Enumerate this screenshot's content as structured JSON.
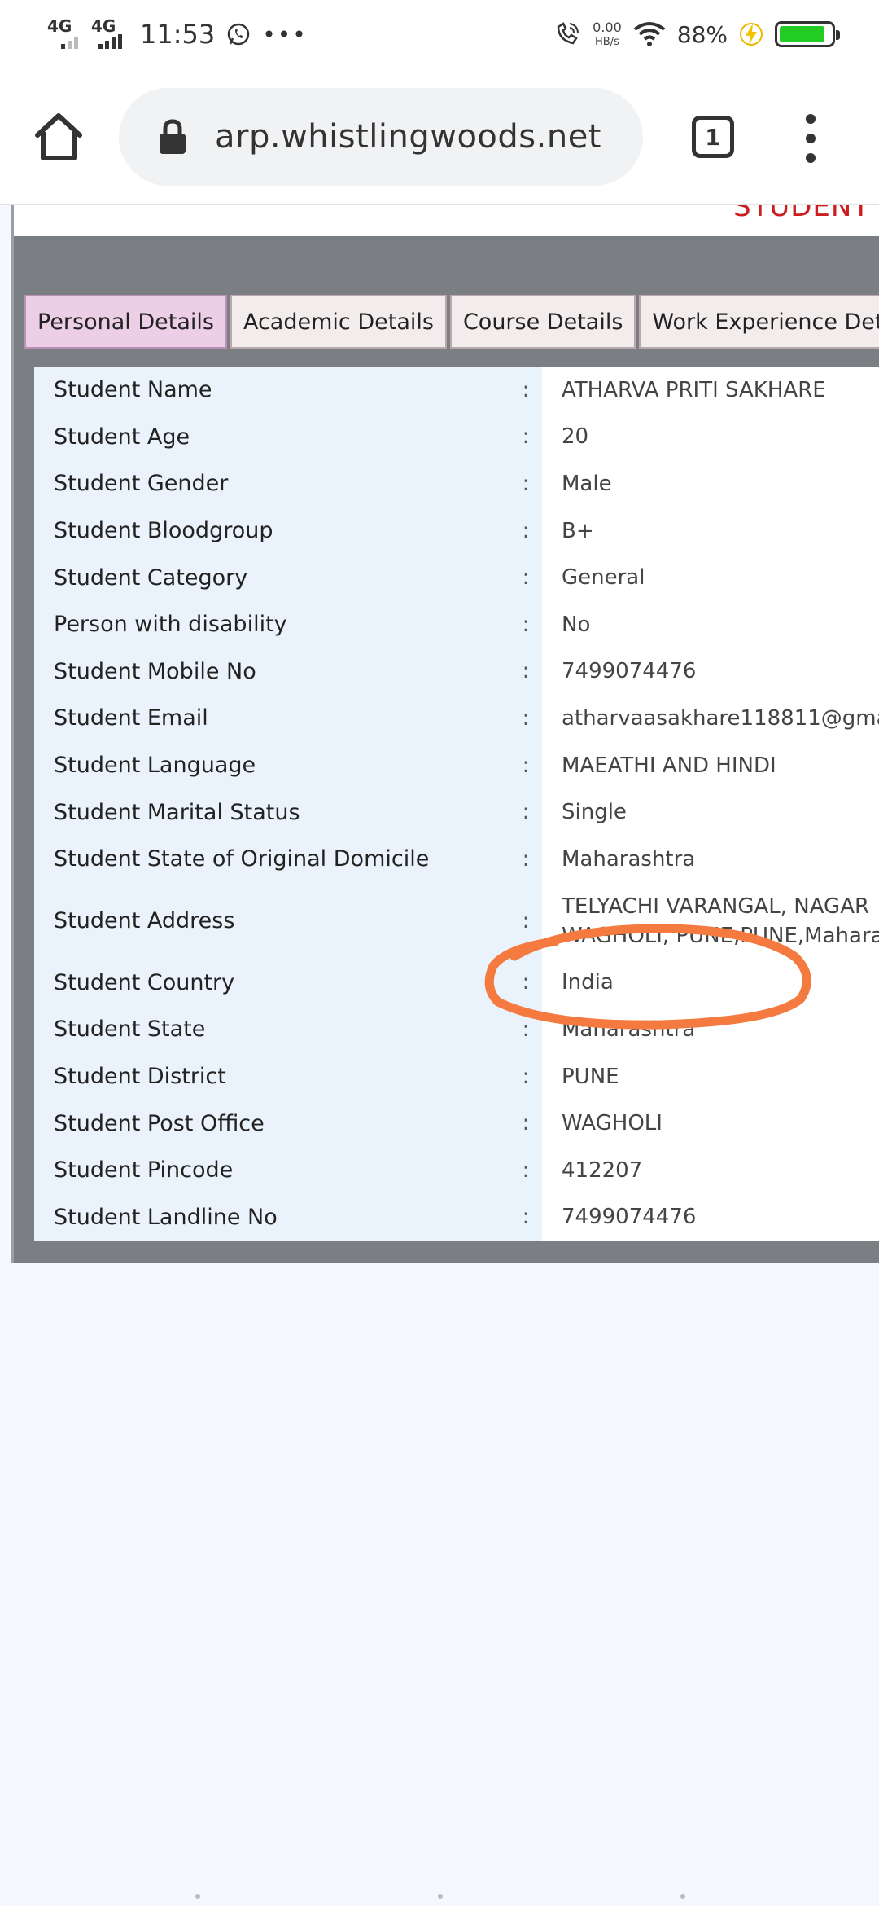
{
  "status_bar": {
    "net1": "4G",
    "net2": "4G",
    "time": "11:53",
    "more": "•••",
    "speed_value": "0.00",
    "speed_unit": "HB/s",
    "battery_pct": "88%"
  },
  "browser": {
    "url": "arp.whistlingwoods.net",
    "tab_count": "1"
  },
  "page": {
    "header_title": "STUDENT PI"
  },
  "tabs": [
    {
      "label": "Personal Details"
    },
    {
      "label": "Academic Details"
    },
    {
      "label": "Course Details"
    },
    {
      "label": "Work Experience Det"
    }
  ],
  "details": {
    "separator": ":",
    "rows": [
      {
        "label": "Student Name",
        "value": "ATHARVA PRITI SAKHARE"
      },
      {
        "label": "Student Age",
        "value": "20"
      },
      {
        "label": "Student Gender",
        "value": "Male"
      },
      {
        "label": "Student Bloodgroup",
        "value": "B+"
      },
      {
        "label": "Student Category",
        "value": "General"
      },
      {
        "label": "Person with disability",
        "value": "No"
      },
      {
        "label": "Student Mobile No",
        "value": "7499074476"
      },
      {
        "label": "Student Email",
        "value": "atharvaasakhare118811@gma"
      },
      {
        "label": "Student Language",
        "value": "MAEATHI AND HINDI"
      },
      {
        "label": "Student Marital Status",
        "value": "Single"
      },
      {
        "label": "Student State of Original Domicile",
        "value": "Maharashtra"
      },
      {
        "label": "Student Address",
        "value": "TELYACHI VARANGAL, NAGAR",
        "value2": "WAGHOLI, PUNE,PUNE,Mahara"
      },
      {
        "label": "Student Country",
        "value": "India"
      },
      {
        "label": "Student State",
        "value": "Maharashtra"
      },
      {
        "label": "Student District",
        "value": "PUNE"
      },
      {
        "label": "Student Post Office",
        "value": "WAGHOLI"
      },
      {
        "label": "Student Pincode",
        "value": "412207"
      },
      {
        "label": "Student Landline No",
        "value": "7499074476"
      }
    ]
  },
  "colors": {
    "annotation": "#f47a3f",
    "active_tab": "#eccee6",
    "panel_gray": "#7b7f83",
    "label_bg": "#eaf3fb",
    "header_red": "#cc1e1e"
  }
}
